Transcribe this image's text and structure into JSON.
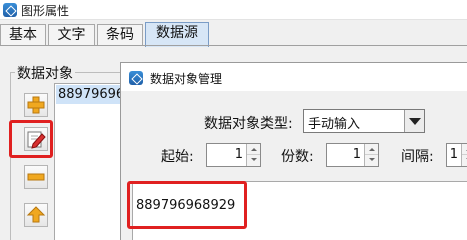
{
  "window": {
    "title": "图形属性"
  },
  "tabs": [
    {
      "label": "基本",
      "active": false
    },
    {
      "label": "文字",
      "active": false
    },
    {
      "label": "条码",
      "active": false
    },
    {
      "label": "数据源",
      "active": true
    }
  ],
  "data_objects": {
    "group_label": "数据对象",
    "items": [
      "889796968929"
    ]
  },
  "side_buttons": [
    {
      "name": "add",
      "icon": "plus-icon"
    },
    {
      "name": "edit",
      "icon": "edit-pencil-icon",
      "highlighted": true
    },
    {
      "name": "remove",
      "icon": "minus-icon"
    },
    {
      "name": "move-up",
      "icon": "arrow-up-icon"
    }
  ],
  "dialog": {
    "title": "数据对象管理",
    "type_label": "数据对象类型:",
    "type_value": "手动输入",
    "start_label": "起始:",
    "start_value": "1",
    "copies_label": "份数:",
    "copies_value": "1",
    "interval_label": "间隔:",
    "interval_value": "1",
    "content_text": "889796968929"
  },
  "colors": {
    "highlight": "#e02020",
    "icon_gold": "#f0a820",
    "selected_row": "#cfe3f8",
    "active_tab": "#d7e6f6"
  }
}
